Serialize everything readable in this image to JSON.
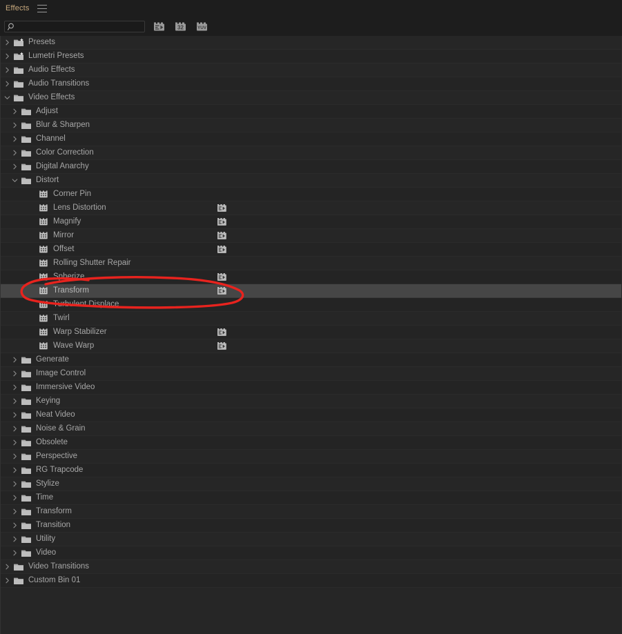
{
  "panel": {
    "tab_label": "Effects",
    "menu_icon": "hamburger-menu-icon",
    "accent_color": "#c8a97e",
    "background_color": "#232323",
    "row_color": "#262626",
    "selected_row_color": "#464646",
    "text_color": "#a7a7a7",
    "annotation_color": "#e8231e"
  },
  "search": {
    "value": "",
    "placeholder": "",
    "icon": "search-icon"
  },
  "filters": [
    {
      "name": "accelerated-effects-filter",
      "label": "Accelerated Effects",
      "icon": "accelerated-effect-icon"
    },
    {
      "name": "32-bit-color-filter",
      "label": "32",
      "icon": "32-bit-color-icon"
    },
    {
      "name": "yuv-color-filter",
      "label": "YUV",
      "icon": "yuv-color-icon"
    }
  ],
  "tree": {
    "rows": [
      {
        "label": "Presets",
        "level": 0,
        "icon": "folder-star-icon",
        "twisty": "collapsed",
        "accel": false,
        "selected": false
      },
      {
        "label": "Lumetri Presets",
        "level": 0,
        "icon": "folder-star-icon",
        "twisty": "collapsed",
        "accel": false,
        "selected": false
      },
      {
        "label": "Audio Effects",
        "level": 0,
        "icon": "folder-icon",
        "twisty": "collapsed",
        "accel": false,
        "selected": false
      },
      {
        "label": "Audio Transitions",
        "level": 0,
        "icon": "folder-icon",
        "twisty": "collapsed",
        "accel": false,
        "selected": false
      },
      {
        "label": "Video Effects",
        "level": 0,
        "icon": "folder-icon",
        "twisty": "expanded",
        "accel": false,
        "selected": false
      },
      {
        "label": "Adjust",
        "level": 1,
        "icon": "folder-icon",
        "twisty": "collapsed",
        "accel": false,
        "selected": false
      },
      {
        "label": "Blur & Sharpen",
        "level": 1,
        "icon": "folder-icon",
        "twisty": "collapsed",
        "accel": false,
        "selected": false
      },
      {
        "label": "Channel",
        "level": 1,
        "icon": "folder-icon",
        "twisty": "collapsed",
        "accel": false,
        "selected": false
      },
      {
        "label": "Color Correction",
        "level": 1,
        "icon": "folder-icon",
        "twisty": "collapsed",
        "accel": false,
        "selected": false
      },
      {
        "label": "Digital Anarchy",
        "level": 1,
        "icon": "folder-icon",
        "twisty": "collapsed",
        "accel": false,
        "selected": false
      },
      {
        "label": "Distort",
        "level": 1,
        "icon": "folder-icon",
        "twisty": "expanded",
        "accel": false,
        "selected": false
      },
      {
        "label": "Corner Pin",
        "level": 2,
        "icon": "effect-icon",
        "twisty": "none",
        "accel": false,
        "selected": false
      },
      {
        "label": "Lens Distortion",
        "level": 2,
        "icon": "effect-icon",
        "twisty": "none",
        "accel": true,
        "selected": false
      },
      {
        "label": "Magnify",
        "level": 2,
        "icon": "effect-icon",
        "twisty": "none",
        "accel": true,
        "selected": false
      },
      {
        "label": "Mirror",
        "level": 2,
        "icon": "effect-icon",
        "twisty": "none",
        "accel": true,
        "selected": false
      },
      {
        "label": "Offset",
        "level": 2,
        "icon": "effect-icon",
        "twisty": "none",
        "accel": true,
        "selected": false
      },
      {
        "label": "Rolling Shutter Repair",
        "level": 2,
        "icon": "effect-icon",
        "twisty": "none",
        "accel": false,
        "selected": false
      },
      {
        "label": "Spherize",
        "level": 2,
        "icon": "effect-icon",
        "twisty": "none",
        "accel": true,
        "selected": false
      },
      {
        "label": "Transform",
        "level": 2,
        "icon": "effect-icon",
        "twisty": "none",
        "accel": true,
        "selected": true
      },
      {
        "label": "Turbulent Displace",
        "level": 2,
        "icon": "effect-icon",
        "twisty": "none",
        "accel": false,
        "selected": false
      },
      {
        "label": "Twirl",
        "level": 2,
        "icon": "effect-icon",
        "twisty": "none",
        "accel": false,
        "selected": false
      },
      {
        "label": "Warp Stabilizer",
        "level": 2,
        "icon": "effect-icon",
        "twisty": "none",
        "accel": true,
        "selected": false
      },
      {
        "label": "Wave Warp",
        "level": 2,
        "icon": "effect-icon",
        "twisty": "none",
        "accel": true,
        "selected": false
      },
      {
        "label": "Generate",
        "level": 1,
        "icon": "folder-icon",
        "twisty": "collapsed",
        "accel": false,
        "selected": false
      },
      {
        "label": "Image Control",
        "level": 1,
        "icon": "folder-icon",
        "twisty": "collapsed",
        "accel": false,
        "selected": false
      },
      {
        "label": "Immersive Video",
        "level": 1,
        "icon": "folder-icon",
        "twisty": "collapsed",
        "accel": false,
        "selected": false
      },
      {
        "label": "Keying",
        "level": 1,
        "icon": "folder-icon",
        "twisty": "collapsed",
        "accel": false,
        "selected": false
      },
      {
        "label": "Neat Video",
        "level": 1,
        "icon": "folder-icon",
        "twisty": "collapsed",
        "accel": false,
        "selected": false
      },
      {
        "label": "Noise & Grain",
        "level": 1,
        "icon": "folder-icon",
        "twisty": "collapsed",
        "accel": false,
        "selected": false
      },
      {
        "label": "Obsolete",
        "level": 1,
        "icon": "folder-icon",
        "twisty": "collapsed",
        "accel": false,
        "selected": false
      },
      {
        "label": "Perspective",
        "level": 1,
        "icon": "folder-icon",
        "twisty": "collapsed",
        "accel": false,
        "selected": false
      },
      {
        "label": "RG Trapcode",
        "level": 1,
        "icon": "folder-icon",
        "twisty": "collapsed",
        "accel": false,
        "selected": false
      },
      {
        "label": "Stylize",
        "level": 1,
        "icon": "folder-icon",
        "twisty": "collapsed",
        "accel": false,
        "selected": false
      },
      {
        "label": "Time",
        "level": 1,
        "icon": "folder-icon",
        "twisty": "collapsed",
        "accel": false,
        "selected": false
      },
      {
        "label": "Transform",
        "level": 1,
        "icon": "folder-icon",
        "twisty": "collapsed",
        "accel": false,
        "selected": false
      },
      {
        "label": "Transition",
        "level": 1,
        "icon": "folder-icon",
        "twisty": "collapsed",
        "accel": false,
        "selected": false
      },
      {
        "label": "Utility",
        "level": 1,
        "icon": "folder-icon",
        "twisty": "collapsed",
        "accel": false,
        "selected": false
      },
      {
        "label": "Video",
        "level": 1,
        "icon": "folder-icon",
        "twisty": "collapsed",
        "accel": false,
        "selected": false
      },
      {
        "label": "Video Transitions",
        "level": 0,
        "icon": "folder-icon",
        "twisty": "collapsed",
        "accel": false,
        "selected": false
      },
      {
        "label": "Custom Bin 01",
        "level": 0,
        "icon": "folder-icon",
        "twisty": "collapsed",
        "accel": false,
        "selected": false
      }
    ]
  },
  "annotation": {
    "shape": "hand-drawn-red-ellipse",
    "target_label": "Transform"
  }
}
